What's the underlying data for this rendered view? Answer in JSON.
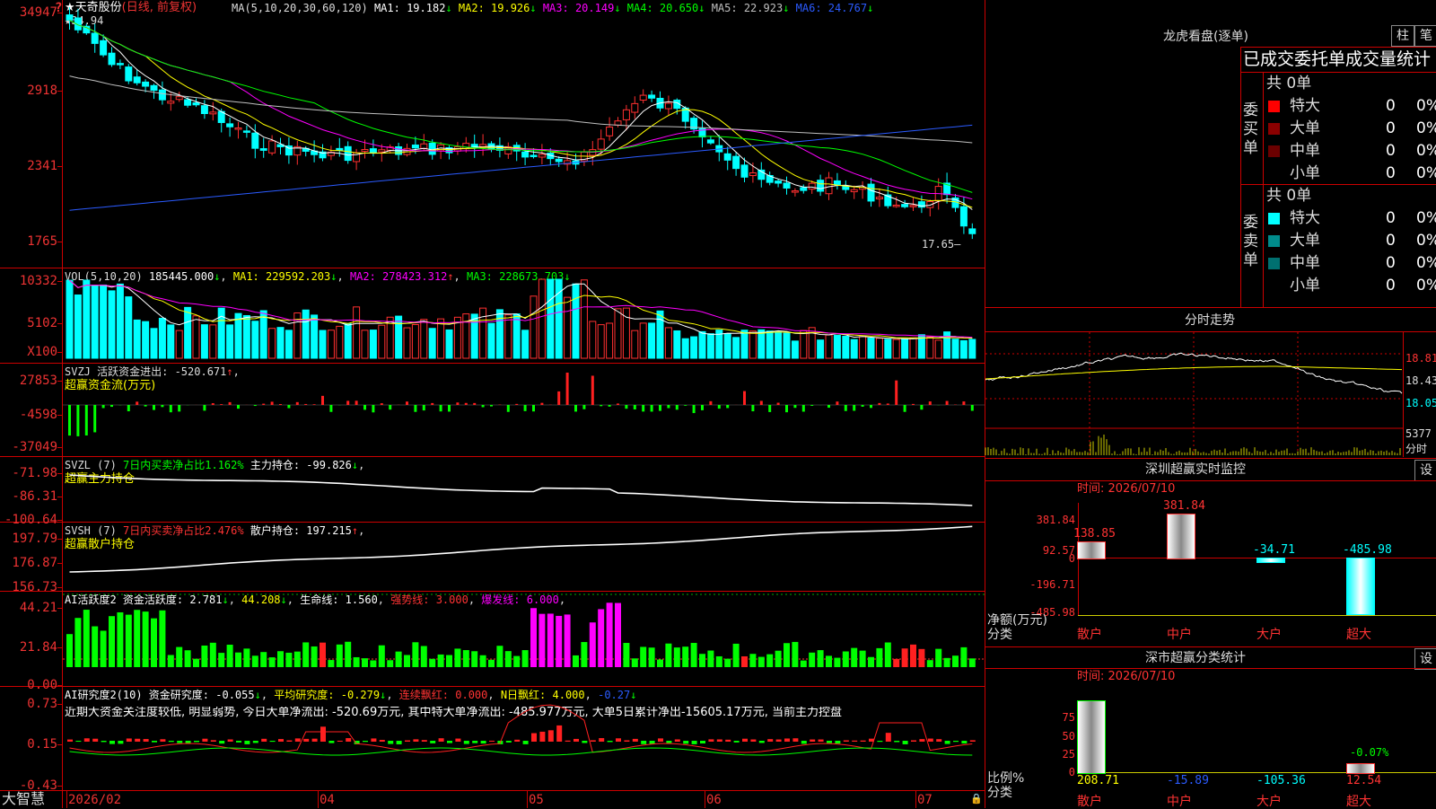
{
  "stock": {
    "name": "★天奇股份",
    "period": "(日线, 前复权)",
    "high_marker": "34.94",
    "low_marker": "17.65",
    "corner_glyph": "?"
  },
  "ma_legend": {
    "prefix": "MA(5,10,20,30,60,120)",
    "items": [
      {
        "label": "MA1:",
        "value": "19.182",
        "arrow": "↓",
        "color": "#ffffff"
      },
      {
        "label": "MA2:",
        "value": "19.926",
        "arrow": "↓",
        "color": "#ffff00"
      },
      {
        "label": "MA3:",
        "value": "20.149",
        "arrow": "↓",
        "color": "#ff00ff"
      },
      {
        "label": "MA4:",
        "value": "20.650",
        "arrow": "↓",
        "color": "#00ff00"
      },
      {
        "label": "MA5:",
        "value": "22.923",
        "arrow": "↓",
        "color": "#c0c0c0"
      },
      {
        "label": "MA6:",
        "value": "24.767",
        "arrow": "↓",
        "color": "#2b5bff"
      }
    ]
  },
  "price_axis": [
    "34947",
    "2918",
    "2341",
    "1765"
  ],
  "volume": {
    "legend": "VOL(5,10,20)",
    "value": "185445.000",
    "arrow": "↓",
    "ma1": "MA1: 229592.203",
    "ma2": "MA2: 278423.312",
    "ma3": "MA3: 228673.703",
    "axis": [
      "10332",
      "5102",
      "X100"
    ]
  },
  "svzj": {
    "legend": "SVZJ  活跃资金进出: -520.671",
    "arrow": "↑",
    "sub": "超赢资金流(万元)",
    "axis": [
      "27853",
      "-4598",
      "-37049"
    ]
  },
  "svzl": {
    "legend": "SVZL (7)",
    "ratio": "7日内买卖净占比1.162%",
    "hold": "主力持仓: -99.826",
    "arrow": "↓",
    "sub": "超赢主力持仓",
    "axis": [
      "-71.98",
      "-86.31",
      "-100.64"
    ]
  },
  "svsh": {
    "legend": "SVSH (7)",
    "ratio": "7日内买卖净占比2.476%",
    "hold": "散户持仓: 197.215",
    "arrow": "↑",
    "sub": "超赢散户持仓",
    "axis": [
      "197.79",
      "176.87",
      "156.73"
    ]
  },
  "ai_active": {
    "legend": "AI活跃度2 资金活跃度: 2.781",
    "v2": "44.208",
    "life": "生命线: 1.560",
    "strong": "强势线: 3.000",
    "burst": "爆发线: 6.000",
    "axis": [
      "44.21",
      "21.84",
      "0.00"
    ]
  },
  "ai_research": {
    "legend": "AI研究度2(10) 资金研究度: -0.055",
    "avg": "平均研究度: -0.279",
    "cont": "连续飘红: 0.000",
    "nred": "N日飘红: 4.000",
    "last": "-0.27",
    "comment": "近期大资金关注度较低, 明显弱势, 今日大单净流出: -520.69万元, 其中特大单净流出: -485.977万元, 大单5日累计净出-15605.17万元, 当前主力控盘",
    "axis": [
      "0.73",
      "0.15",
      "-0.43"
    ]
  },
  "date_axis": [
    "2026/02",
    "04",
    "05",
    "06",
    "07"
  ],
  "brand": "大智慧",
  "right": {
    "longhu_title": "龙虎看盘(逐单)",
    "btn_zhu": "柱",
    "btn_bi": "笔",
    "stat_title": "已成交委托单成交量统计",
    "buy": {
      "side": "委买单",
      "total": "共 0单",
      "rows": [
        {
          "label": "特大",
          "n": "0",
          "p": "0%",
          "color": "#ff0000"
        },
        {
          "label": "大单",
          "n": "0",
          "p": "0%",
          "color": "#8b0000"
        },
        {
          "label": "中单",
          "n": "0",
          "p": "0%",
          "color": "#6b0000"
        },
        {
          "label": "小单",
          "n": "0",
          "p": "0%",
          "color": "#000000"
        }
      ]
    },
    "sell": {
      "side": "委卖单",
      "total": "共 0单",
      "rows": [
        {
          "label": "特大",
          "n": "0",
          "p": "0%",
          "color": "#00ffff"
        },
        {
          "label": "大单",
          "n": "0",
          "p": "0%",
          "color": "#008b8b"
        },
        {
          "label": "中单",
          "n": "0",
          "p": "0%",
          "color": "#007070"
        },
        {
          "label": "小单",
          "n": "0",
          "p": "0%",
          "color": "#000000"
        }
      ]
    },
    "intraday_title": "分时走势",
    "intraday_axis": [
      "18.81",
      "18.43",
      "18.05"
    ],
    "intraday_vol": "5377",
    "intraday_vol_label": "分时",
    "monitor_title": "深圳超赢实时监控",
    "btn_set": "设",
    "monitor_time": "时间: 2026/07/10",
    "monitor_axis": [
      "381.84",
      "92.57",
      "0",
      "-196.71",
      "-485.98"
    ],
    "monitor_unit": "净额(万元)",
    "monitor_cat_label": "分类",
    "monitor_bars": [
      {
        "cat": "散户",
        "value": 138.85,
        "label": "138.85"
      },
      {
        "cat": "中户",
        "value": 381.84,
        "label": "381.84"
      },
      {
        "cat": "大户",
        "value": -34.71,
        "label": "-34.71"
      },
      {
        "cat": "超大",
        "value": -485.98,
        "label": "-485.98"
      }
    ],
    "class_title": "深市超赢分类统计",
    "class_time": "时间: 2026/07/10",
    "class_axis": [
      "75",
      "50",
      "25",
      "0"
    ],
    "class_unit": "比例%",
    "class_cat_label": "分类",
    "class_top": "-0.07%",
    "class_bars": [
      {
        "cat": "散户",
        "value": 208.71,
        "label": "208.71",
        "pct": 100
      },
      {
        "cat": "中户",
        "value": -15.89,
        "label": "-15.89",
        "pct": 0
      },
      {
        "cat": "大户",
        "value": -105.36,
        "label": "-105.36",
        "pct": 0
      },
      {
        "cat": "超大",
        "value": 12.54,
        "label": "12.54",
        "pct": 12
      }
    ]
  }
}
